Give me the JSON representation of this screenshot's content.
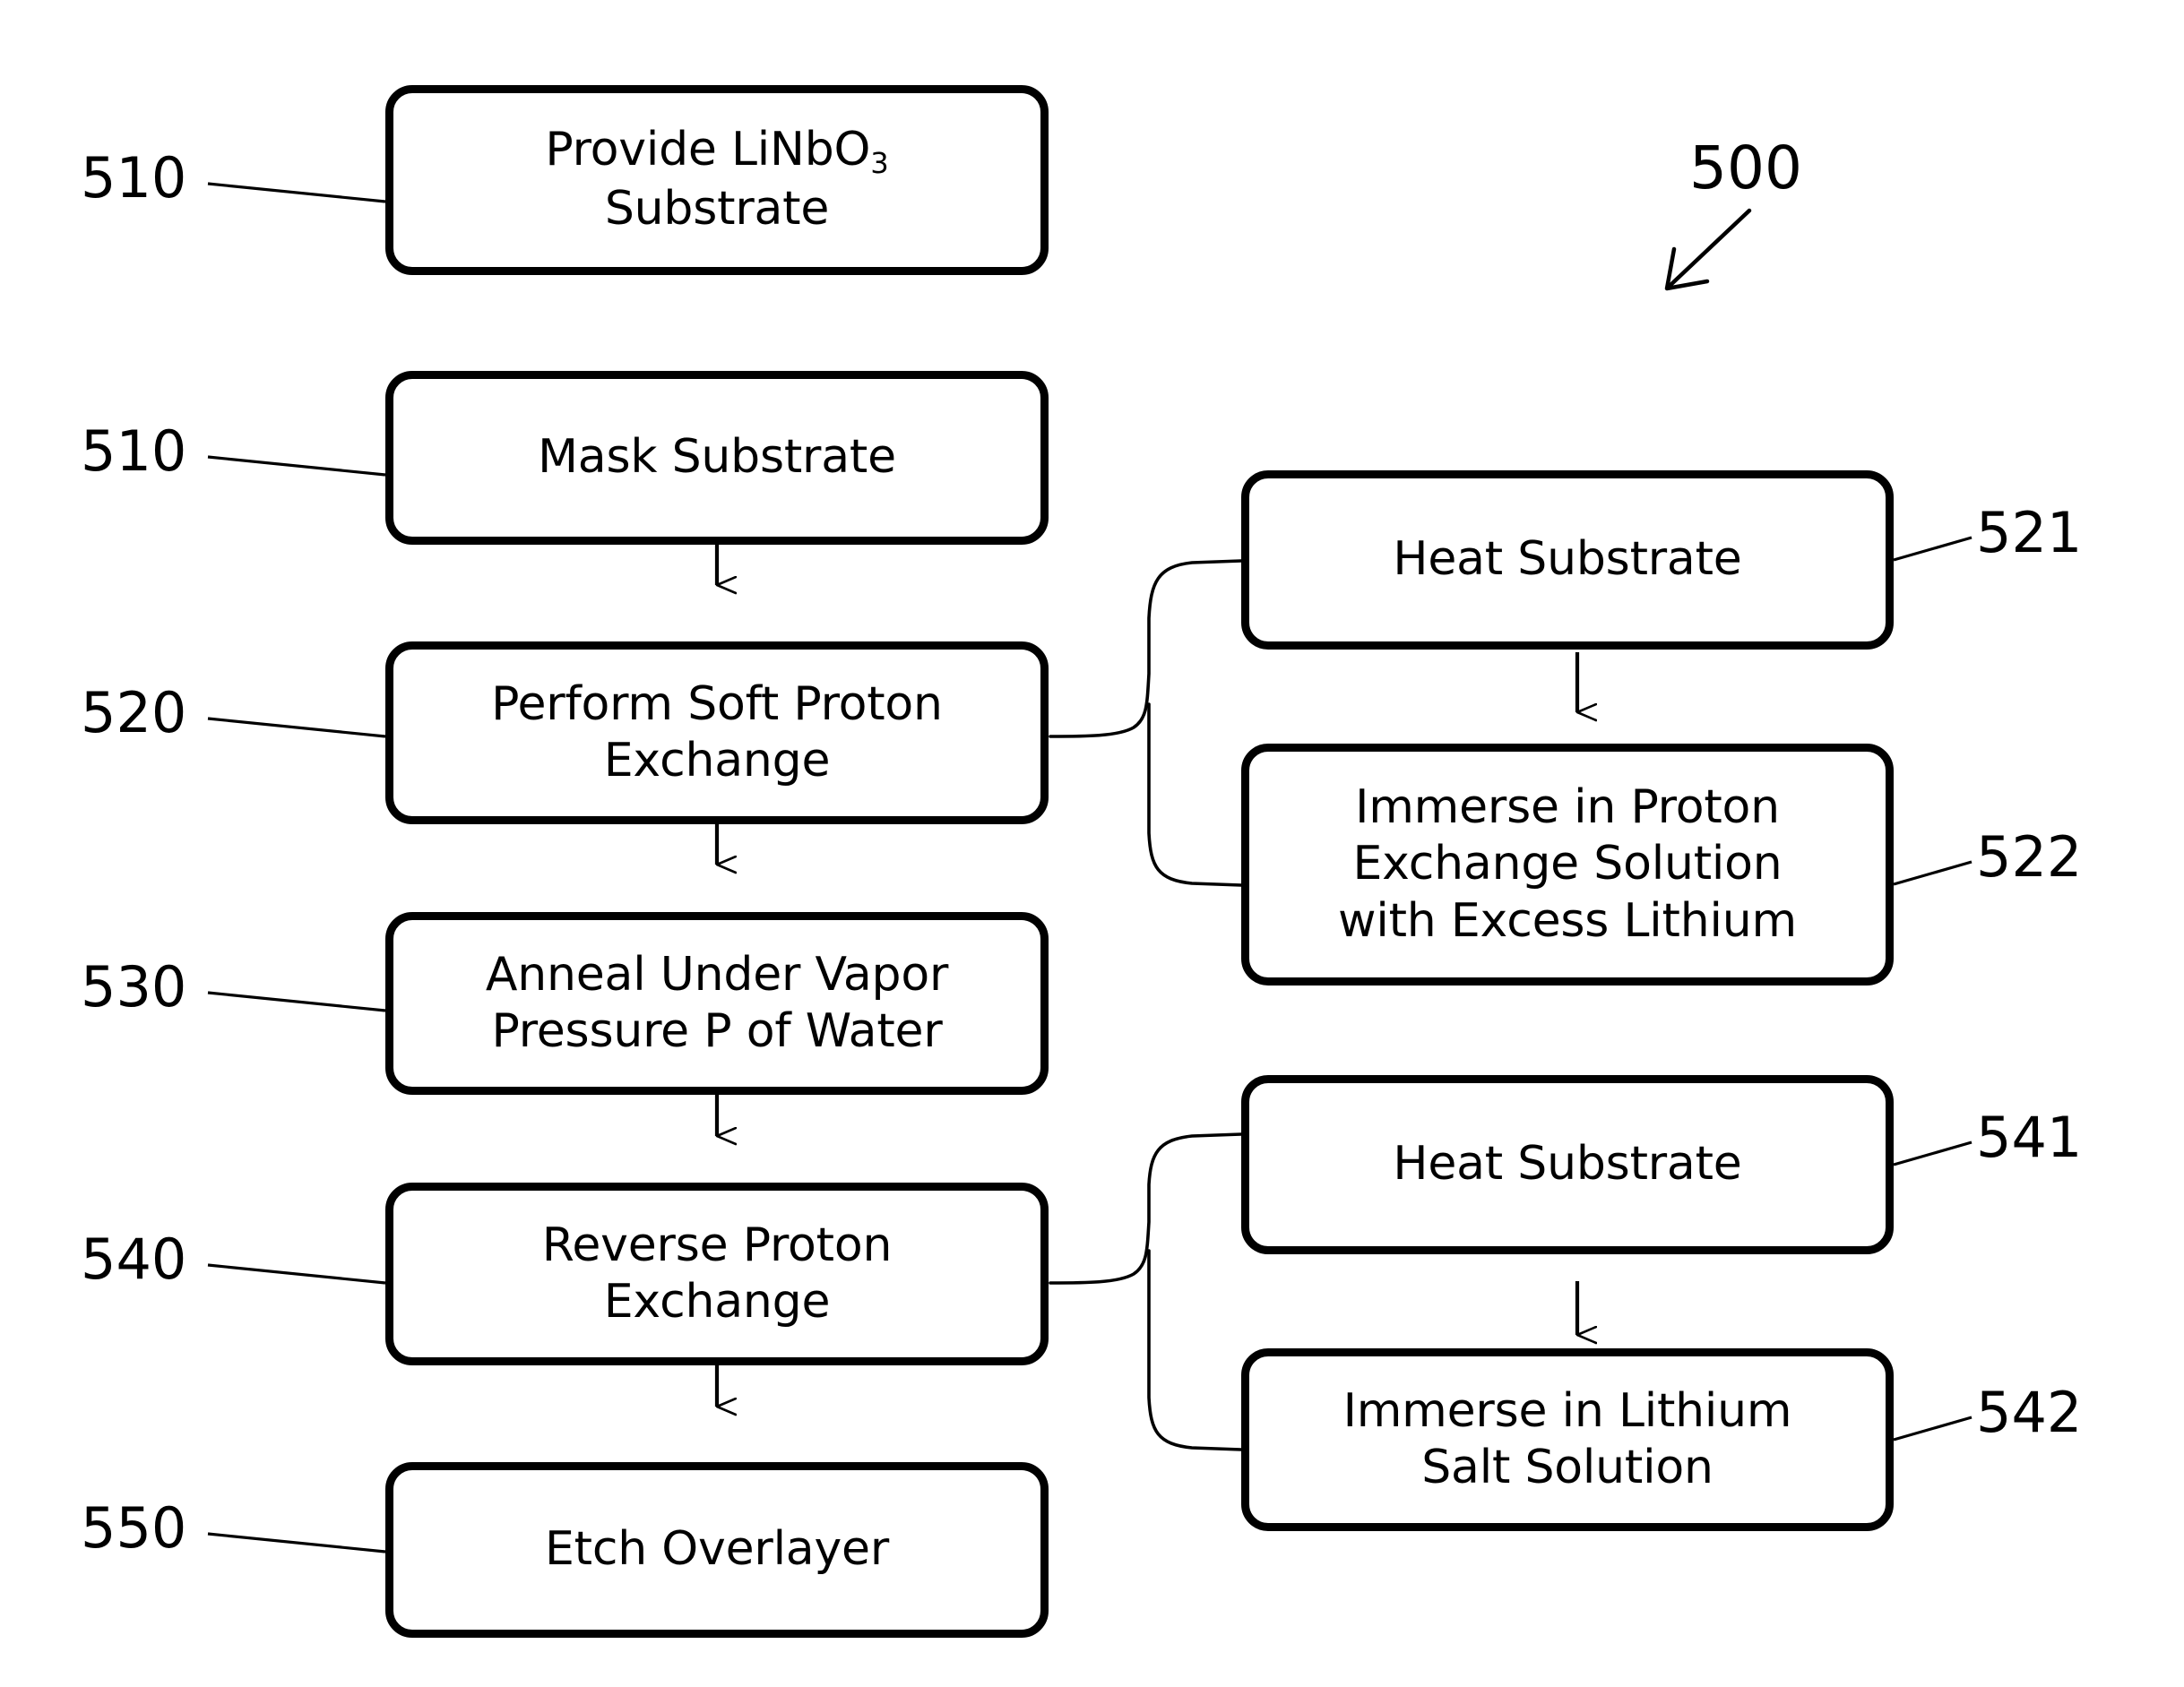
{
  "figure": {
    "number": "500",
    "type": "process-flowchart",
    "title_text_visible": false
  },
  "left_column": {
    "steps": [
      {
        "ref": "510",
        "label_line1": "Provide LiNbO",
        "label_subscript": "3",
        "label_line2": "Substrate",
        "full_label": "Provide LiNbO3 Substrate"
      },
      {
        "ref": "510",
        "label_line1": "Mask Substrate",
        "full_label": "Mask Substrate"
      },
      {
        "ref": "520",
        "label_line1": "Perform Soft Proton",
        "label_line2": "Exchange",
        "full_label": "Perform Soft Proton Exchange"
      },
      {
        "ref": "530",
        "label_line1": "Anneal Under Vapor",
        "label_line2": "Pressure P of Water",
        "full_label": "Anneal Under Vapor Pressure P of Water"
      },
      {
        "ref": "540",
        "label_line1": "Reverse Proton",
        "label_line2": "Exchange",
        "full_label": "Reverse Proton Exchange"
      },
      {
        "ref": "550",
        "label_line1": "Etch Overlayer",
        "full_label": "Etch Overlayer"
      }
    ]
  },
  "right_column": {
    "groups": [
      {
        "parent_ref": "520",
        "steps": [
          {
            "ref": "521",
            "label_line1": "Heat Substrate",
            "full_label": "Heat Substrate"
          },
          {
            "ref": "522",
            "label_line1": "Immerse in Proton",
            "label_line2": "Exchange Solution",
            "label_line3": "with Excess Lithium",
            "full_label": "Immerse in Proton Exchange Solution with Excess Lithium"
          }
        ]
      },
      {
        "parent_ref": "540",
        "steps": [
          {
            "ref": "541",
            "label_line1": "Heat Substrate",
            "full_label": "Heat Substrate"
          },
          {
            "ref": "542",
            "label_line1": "Immerse in Lithium",
            "label_line2": "Salt Solution",
            "full_label": "Immerse in Lithium Salt Solution"
          }
        ]
      }
    ]
  },
  "colors": {
    "stroke": "#000000",
    "background": "#ffffff",
    "text": "#000000"
  }
}
